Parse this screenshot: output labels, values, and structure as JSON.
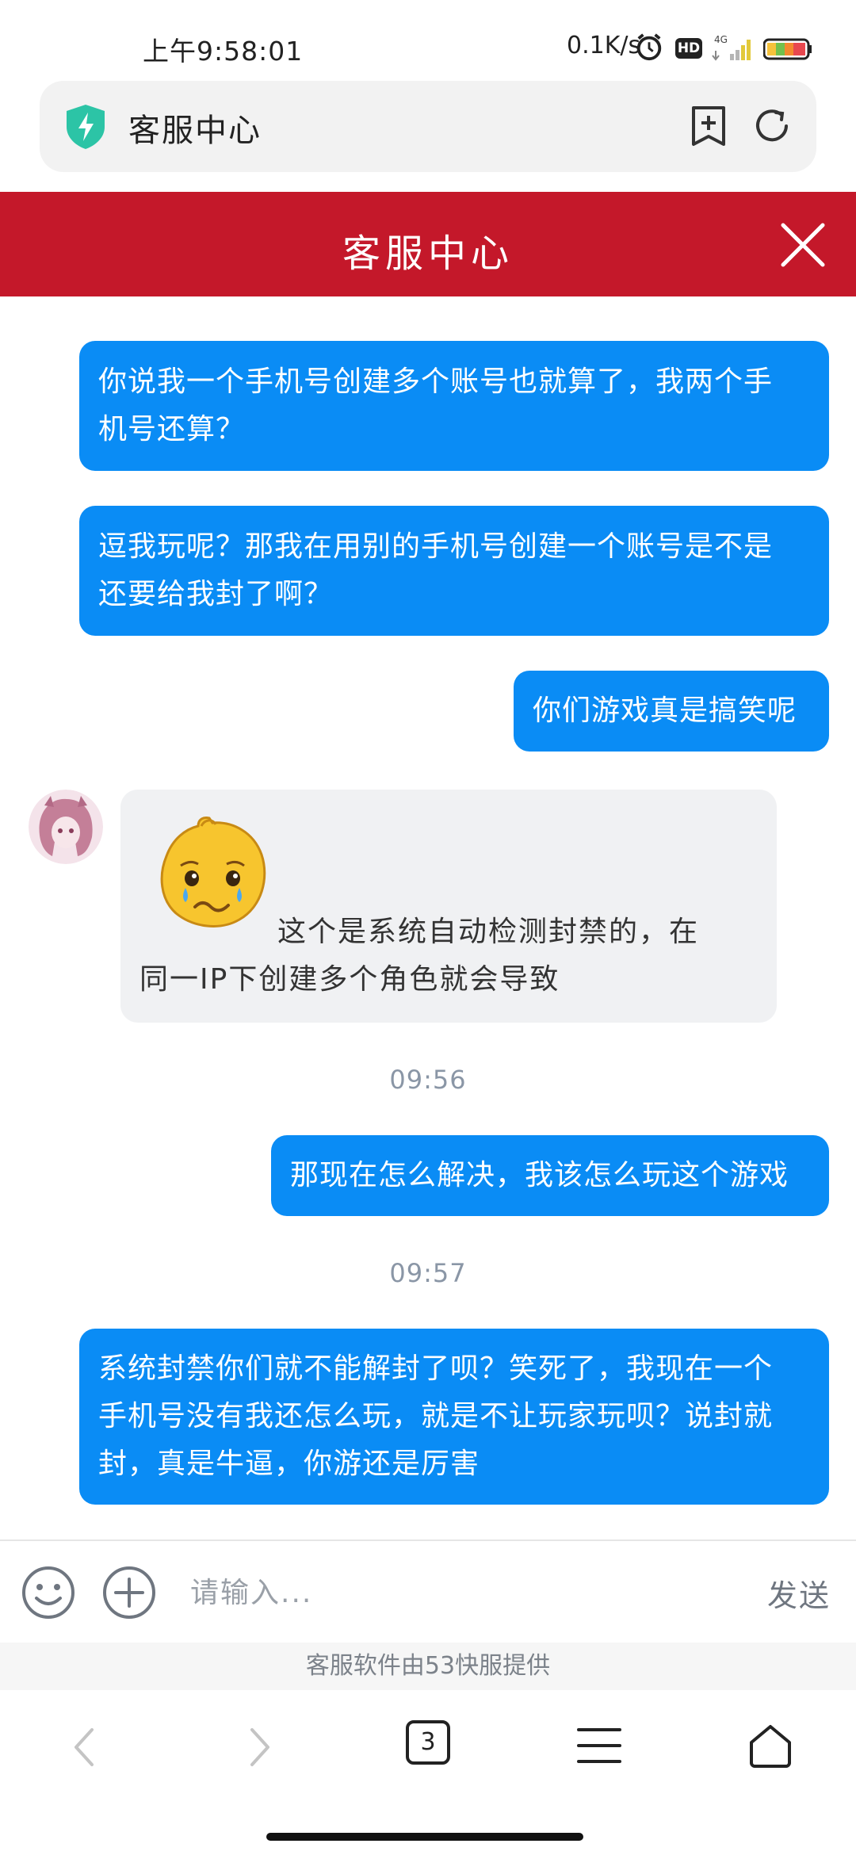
{
  "status_bar": {
    "time": "上午9:58:01",
    "net_speed": "0.1K/s",
    "hd_label": "HD",
    "network": "4G",
    "icons": [
      "alarm-icon",
      "signal-icon",
      "battery-icon"
    ]
  },
  "browser": {
    "page_title": "客服中心",
    "tab_count": "3",
    "icons": [
      "shield-icon",
      "bookmark-add-icon",
      "refresh-icon",
      "back-icon",
      "forward-icon",
      "menu-icon",
      "home-icon"
    ]
  },
  "chat": {
    "header_title": "客服中心",
    "accent_color": "#c4182a",
    "outgoing_color": "#0a8cf5",
    "messages": [
      {
        "from": "user",
        "lines": [
          "你说我一个手机号创建多个账号也就算了，我两个手",
          "机号还算？"
        ]
      },
      {
        "from": "user",
        "lines": [
          "逗我玩呢？那我在用别的手机号创建一个账号是不是",
          "还要给我封了啊？"
        ]
      },
      {
        "from": "user",
        "lines": [
          "你们游戏真是搞笑呢"
        ]
      },
      {
        "from": "agent",
        "emoji": "crying-face",
        "lines": [
          "这个是系统自动检测封禁的，在",
          "同一IP下创建多个角色就会导致"
        ]
      },
      {
        "from": "user",
        "lines": [
          "那现在怎么解决，我该怎么玩这个游戏"
        ]
      },
      {
        "from": "user",
        "lines": [
          "系统封禁你们就不能解封了呗？笑死了，我现在一个",
          "手机号没有我还怎么玩，就是不让玩家玩呗？说封就",
          "封，真是牛逼，你游还是厉害"
        ]
      }
    ],
    "timestamps": [
      "09:56",
      "09:57"
    ]
  },
  "composer": {
    "placeholder": "请输入...",
    "value": "",
    "send_label": "发送"
  },
  "footer": {
    "provider_text": "客服软件由53快服提供"
  }
}
